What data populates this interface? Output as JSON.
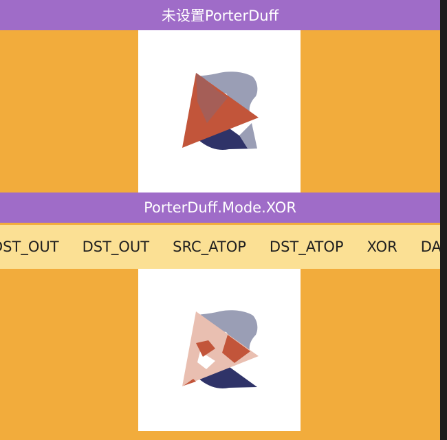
{
  "header": {
    "title": "未设置PorterDuff"
  },
  "section": {
    "title": "PorterDuff.Mode.XOR"
  },
  "modes": [
    "DST_OUT",
    "DST_OUT",
    "SRC_ATOP",
    "DST_ATOP",
    "XOR",
    "DARKEN"
  ],
  "colors": {
    "background": "#F2AC3C",
    "title_bar": "#9F6CC8",
    "mode_strip": "#FBE094",
    "canvas": "#FFFFFF",
    "dst_shape": "#2E3267",
    "src_triangle": "#C2553A"
  }
}
